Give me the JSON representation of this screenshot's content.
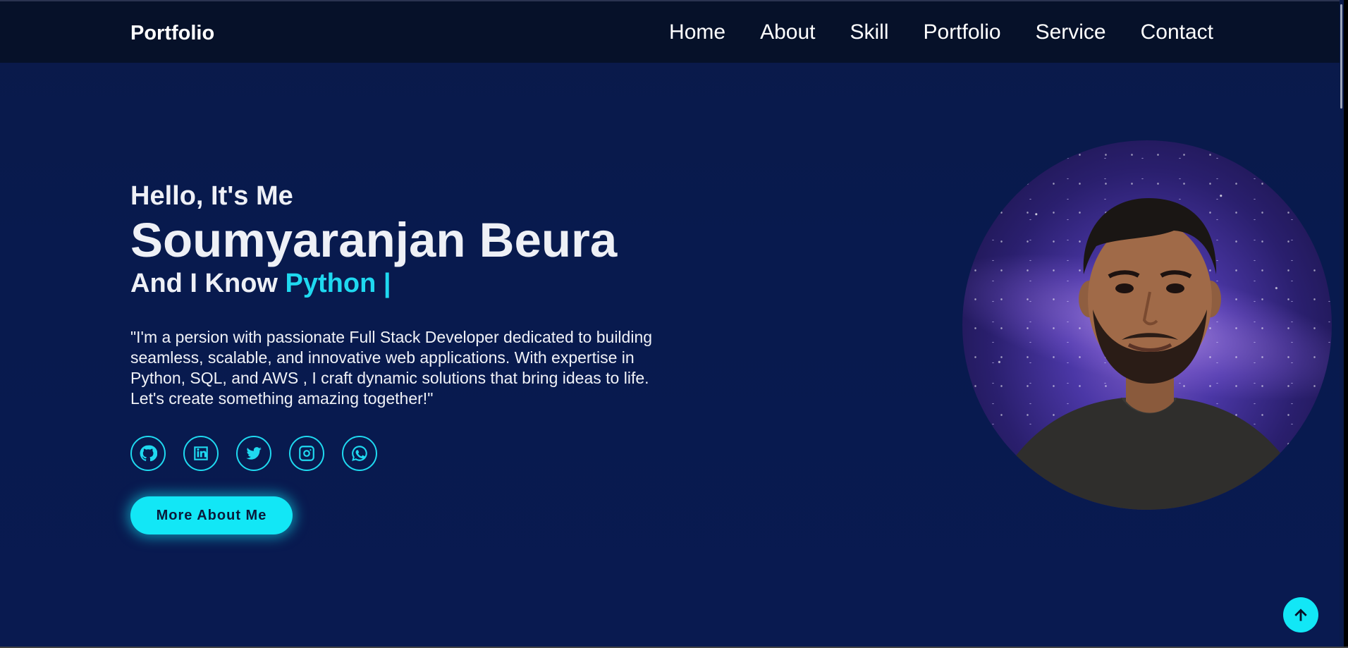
{
  "header": {
    "logo": "Portfolio",
    "nav": [
      "Home",
      "About",
      "Skill",
      "Portfolio",
      "Service",
      "Contact"
    ]
  },
  "hero": {
    "greeting": "Hello, It's Me",
    "name": "Soumyaranjan Beura",
    "know_prefix": "And I Know ",
    "skill": "Python |",
    "bio": "\"I'm a persion with passionate Full Stack Developer dedicated to building seamless, scalable, and innovative web applications. With expertise in Python, SQL, and AWS , I craft dynamic solutions that bring ideas to life. Let's create something amazing together!\"",
    "socials": [
      {
        "icon": "github-icon"
      },
      {
        "icon": "linkedin-icon"
      },
      {
        "icon": "twitter-icon"
      },
      {
        "icon": "instagram-icon"
      },
      {
        "icon": "whatsapp-icon"
      }
    ],
    "cta_label": "More About Me"
  },
  "colors": {
    "accent": "#12e7f6",
    "background": "#081a4e",
    "navbar": "#061129"
  },
  "icons": {
    "scroll_top": "arrow-up-icon",
    "profile": "profile-photo"
  }
}
